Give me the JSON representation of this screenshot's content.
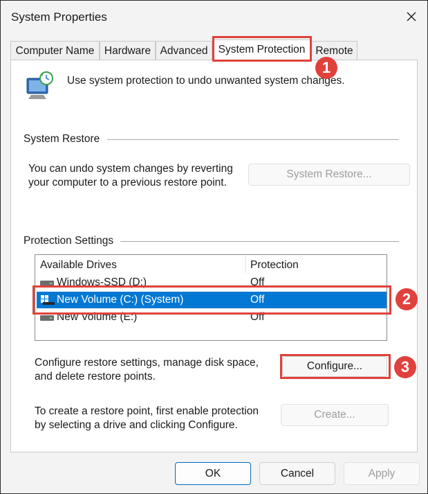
{
  "window": {
    "title": "System Properties"
  },
  "tabs": [
    {
      "label": "Computer Name"
    },
    {
      "label": "Hardware"
    },
    {
      "label": "Advanced"
    },
    {
      "label": "System Protection",
      "active": true
    },
    {
      "label": "Remote"
    }
  ],
  "intro": {
    "text": "Use system protection to undo unwanted system changes."
  },
  "system_restore": {
    "group_label": "System Restore",
    "description_line1": "You can undo system changes by reverting",
    "description_line2": "your computer to a previous restore point.",
    "button_label": "System Restore..."
  },
  "protection_settings": {
    "group_label": "Protection Settings",
    "columns": [
      "Available Drives",
      "Protection"
    ],
    "drives": [
      {
        "name": "Windows-SSD (D:)",
        "protection": "Off",
        "selected": false
      },
      {
        "name": "New Volume (C:) (System)",
        "protection": "Off",
        "selected": true
      },
      {
        "name": "New Volume (E:)",
        "protection": "Off",
        "selected": false
      }
    ],
    "configure_line1": "Configure restore settings, manage disk space,",
    "configure_line2": "and delete restore points.",
    "configure_button": "Configure...",
    "create_line1": "To create a restore point, first enable protection",
    "create_line2": "by selecting a drive and clicking Configure.",
    "create_button": "Create..."
  },
  "footer": {
    "ok": "OK",
    "cancel": "Cancel",
    "apply": "Apply"
  },
  "annotations": {
    "badge1": "1",
    "badge2": "2",
    "badge3": "3"
  },
  "colors": {
    "highlight": "#e0413c",
    "selection": "#0078d4",
    "primary_border": "#0067c0"
  }
}
